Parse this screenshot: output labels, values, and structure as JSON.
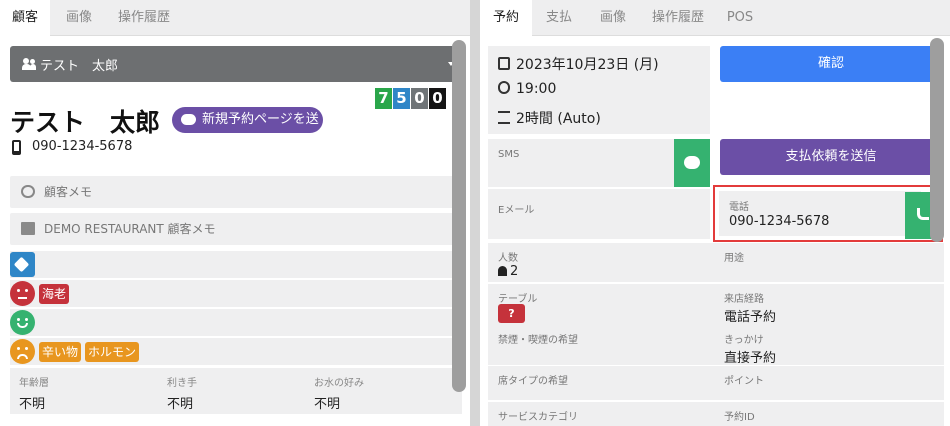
{
  "left": {
    "tabs": [
      {
        "label": "顧客",
        "active": true
      },
      {
        "label": "画像",
        "active": false
      },
      {
        "label": "操作履歴",
        "active": false
      }
    ],
    "customer_select": {
      "value": "テスト　太郎",
      "icon": "users-icon"
    },
    "rank_digits": [
      {
        "digit": "7",
        "color": "#2aa64a"
      },
      {
        "digit": "5",
        "color": "#2f86c7"
      },
      {
        "digit": "0",
        "color": "#6f7477"
      },
      {
        "digit": "0",
        "color": "#141414"
      }
    ],
    "customer_name": "テスト　太郎",
    "send_reservation_button": "新規予約ページを送る",
    "phone": "090-1234-5678",
    "customer_memo_label": "顧客メモ",
    "restaurant_memo_label": "DEMO RESTAURANT 顧客メモ",
    "tag_rows": [
      {
        "icon": "tag-icon",
        "color": "#2f86c7",
        "chips": []
      },
      {
        "icon": "dislike-face-icon",
        "color": "#c5323b",
        "chips": [
          "海老"
        ]
      },
      {
        "icon": "smile-face-icon",
        "color": "#35b270",
        "chips": []
      },
      {
        "icon": "frown-face-icon",
        "color": "#e8961f",
        "chips": [
          "辛い物",
          "ホルモン"
        ]
      }
    ],
    "preferences": [
      {
        "label": "年齢層",
        "value": "不明"
      },
      {
        "label": "利き手",
        "value": "不明"
      },
      {
        "label": "お水の好み",
        "value": "不明"
      }
    ]
  },
  "right": {
    "tabs": [
      {
        "label": "予約",
        "active": true
      },
      {
        "label": "支払",
        "active": false
      },
      {
        "label": "画像",
        "active": false
      },
      {
        "label": "操作履歴",
        "active": false
      },
      {
        "label": "POS",
        "active": false
      }
    ],
    "date": "2023年10月23日 (月)",
    "time": "19:00",
    "duration": "2時間 (Auto)",
    "confirm_button": "確認",
    "sms_label": "SMS",
    "payment_request_button": "支払依頼を送信",
    "email_label": "Eメール",
    "tel_label": "電話",
    "tel_value": "090-1234-5678",
    "fields": [
      [
        {
          "label": "人数",
          "value": "2"
        },
        {
          "label": "用途",
          "value": ""
        }
      ],
      [
        {
          "label": "テーブル",
          "value": ""
        },
        {
          "label": "来店経路",
          "value": "電話予約"
        }
      ],
      [
        {
          "label": "禁煙・喫煙の希望",
          "value": ""
        },
        {
          "label": "きっかけ",
          "value": "直接予約"
        }
      ],
      [
        {
          "label": "席タイプの希望",
          "value": ""
        },
        {
          "label": "ポイント",
          "value": ""
        }
      ],
      [
        {
          "label": "サービスカテゴリ",
          "value": ""
        },
        {
          "label": "予約ID",
          "value": ""
        }
      ]
    ],
    "table_badge": "?",
    "colors": {
      "confirm": "#3b7ff5",
      "payment": "#6b4fa6",
      "sms_green": "#35b270",
      "highlight": "#e33b3b",
      "table_red": "#c5323b"
    }
  }
}
